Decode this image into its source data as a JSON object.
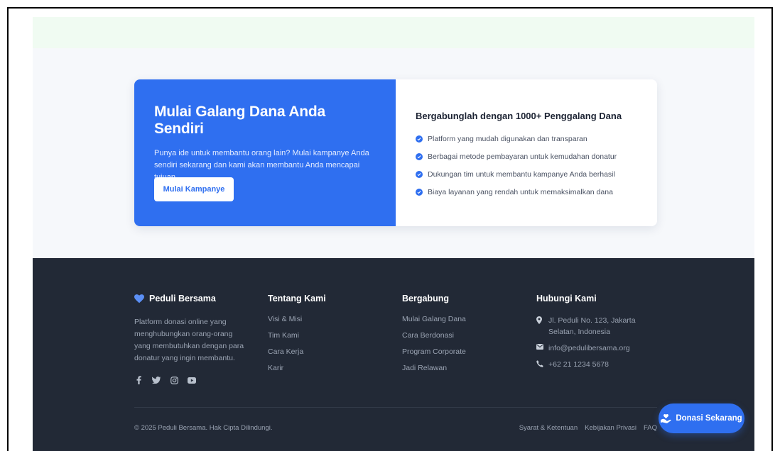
{
  "cta": {
    "title": "Mulai Galang Dana Anda Sendiri",
    "description": "Punya ide untuk membantu orang lain? Mulai kampanye Anda sendiri sekarang dan kami akan membantu Anda mencapai tujuan.",
    "button_label": "Mulai Kampanye",
    "benefits_title": "Bergabunglah dengan 1000+ Penggalang Dana",
    "benefits": [
      "Platform yang mudah digunakan dan transparan",
      "Berbagai metode pembayaran untuk kemudahan donatur",
      "Dukungan tim untuk membantu kampanye Anda berhasil",
      "Biaya layanan yang rendah untuk memaksimalkan dana"
    ]
  },
  "footer": {
    "brand": {
      "name": "Peduli Bersama",
      "description": "Platform donasi online yang menghubungkan orang-orang yang membutuhkan dengan para donatur yang ingin membantu."
    },
    "about": {
      "title": "Tentang Kami",
      "links": [
        "Visi & Misi",
        "Tim Kami",
        "Cara Kerja",
        "Karir"
      ]
    },
    "join": {
      "title": "Bergabung",
      "links": [
        "Mulai Galang Dana",
        "Cara Berdonasi",
        "Program Corporate",
        "Jadi Relawan"
      ]
    },
    "contact": {
      "title": "Hubungi Kami",
      "address": "Jl. Peduli No. 123, Jakarta Selatan, Indonesia",
      "email": "info@pedulibersama.org",
      "phone": "+62 21 1234 5678"
    },
    "copyright": "© 2025 Peduli Bersama. Hak Cipta Dilindungi.",
    "legal": [
      "Syarat & Ketentuan",
      "Kebijakan Privasi",
      "FAQ"
    ]
  },
  "fab": {
    "label": "Donasi Sekarang"
  },
  "colors": {
    "primary": "#2f6ff0",
    "footer_bg": "#222936",
    "section_bg": "#f6f8fb"
  }
}
